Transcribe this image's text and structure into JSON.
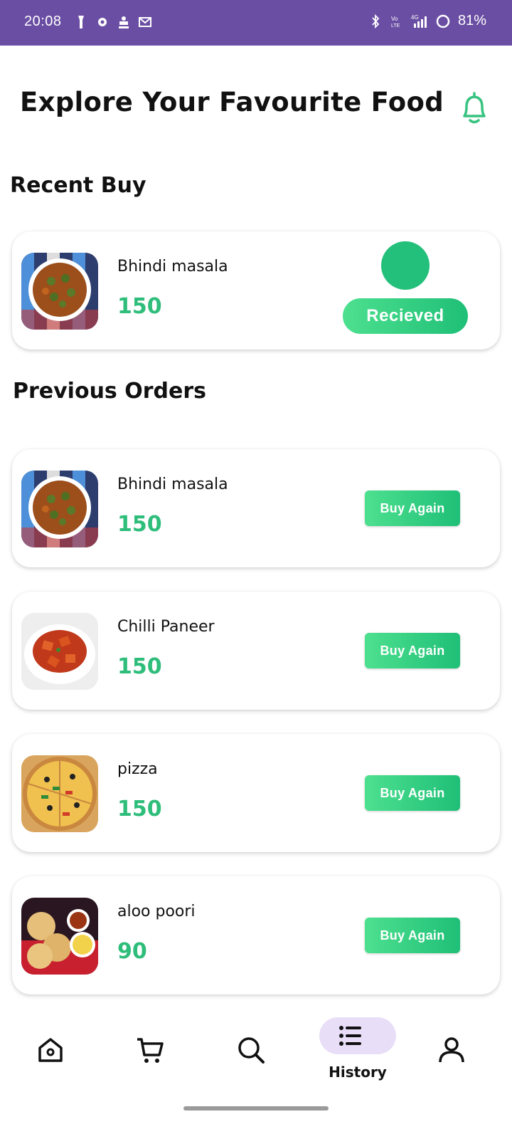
{
  "status_bar": {
    "time": "20:08",
    "battery": "81%",
    "icons": [
      "torch-icon",
      "vpn-icon",
      "app-notification-icon",
      "gmail-icon",
      "bluetooth-icon",
      "volte-icon",
      "signal-4g-icon",
      "battery-ring-icon"
    ]
  },
  "header": {
    "title": "Explore Your Favourite Food",
    "bell_icon": "bell-icon"
  },
  "recent_buy": {
    "section_title": "Recent Buy",
    "item": {
      "name": "Bhindi masala",
      "price": "150",
      "status_label": "Recieved",
      "image": "bhindi-masala-photo"
    }
  },
  "previous_orders": {
    "section_title": "Previous Orders",
    "items": [
      {
        "name": "Bhindi masala",
        "price": "150",
        "button": "Buy Again",
        "image": "bhindi-masala-photo"
      },
      {
        "name": "Chilli Paneer",
        "price": "150",
        "button": "Buy Again",
        "image": "chilli-paneer-photo"
      },
      {
        "name": "pizza",
        "price": "150",
        "button": "Buy Again",
        "image": "pizza-photo"
      },
      {
        "name": "aloo poori",
        "price": "90",
        "button": "Buy Again",
        "image": "aloo-poori-photo"
      }
    ]
  },
  "bottom_nav": {
    "items": [
      {
        "icon": "home-icon"
      },
      {
        "icon": "cart-icon"
      },
      {
        "icon": "search-icon"
      },
      {
        "icon": "history-list-icon",
        "label": "History",
        "active": true
      },
      {
        "icon": "profile-icon"
      }
    ]
  },
  "colors": {
    "status_bar": "#6a4ea3",
    "accent_green": "#2ebd7a",
    "nav_active_pill": "#e9def8"
  }
}
